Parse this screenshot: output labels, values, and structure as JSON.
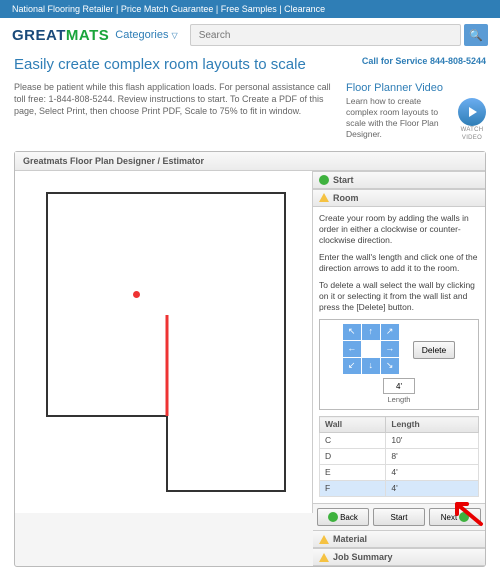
{
  "topbar": "National Flooring Retailer  |  Price Match Guarantee  |  Free Samples  |  Clearance",
  "logo_a": "GREAT",
  "logo_b": "MATS",
  "categories": "Categories",
  "search_placeholder": "Search",
  "heading": "Easily create complex room layouts to scale",
  "call": "Call for Service 844-808-5244",
  "instructions": "Please be patient while this flash application loads.\nFor personal assistance call toll free: 1-844-808-5244. Review instructions to start. To Create a PDF of this page, Select Print, then choose Print PDF, Scale to 75% to fit in window.",
  "video": {
    "title": "Floor Planner Video",
    "desc": "Learn how to create complex room layouts to scale with the Floor Plan Designer.",
    "watch": "WATCH VIDEO"
  },
  "app_title": "Greatmats Floor Plan Designer / Estimator",
  "sections": {
    "start": "Start",
    "room": "Room",
    "material": "Material",
    "job": "Job Summary"
  },
  "room_help": {
    "p1": "Create your room by adding the walls in order in either a clockwise or counter-clockwise direction.",
    "p2": "Enter the wall's length and click one of the direction arrows to add it to the room.",
    "p3": "To delete a wall select the wall by clicking on it or selecting it from the wall list and press the [Delete] button."
  },
  "length_value": "4'",
  "length_label": "Length",
  "delete_label": "Delete",
  "wall_header": {
    "wall": "Wall",
    "len": "Length"
  },
  "walls": [
    {
      "id": "C",
      "len": "10'"
    },
    {
      "id": "D",
      "len": "8'"
    },
    {
      "id": "E",
      "len": "4'"
    },
    {
      "id": "F",
      "len": "4'"
    }
  ],
  "selected_wall": "F",
  "buttons": {
    "back": "Back",
    "start": "Start",
    "next": "Next"
  },
  "chart_data": {
    "type": "table",
    "title": "Wall list",
    "columns": [
      "Wall",
      "Length"
    ],
    "rows": [
      [
        "C",
        "10'"
      ],
      [
        "D",
        "8'"
      ],
      [
        "E",
        "4'"
      ],
      [
        "F",
        "4'"
      ]
    ]
  }
}
